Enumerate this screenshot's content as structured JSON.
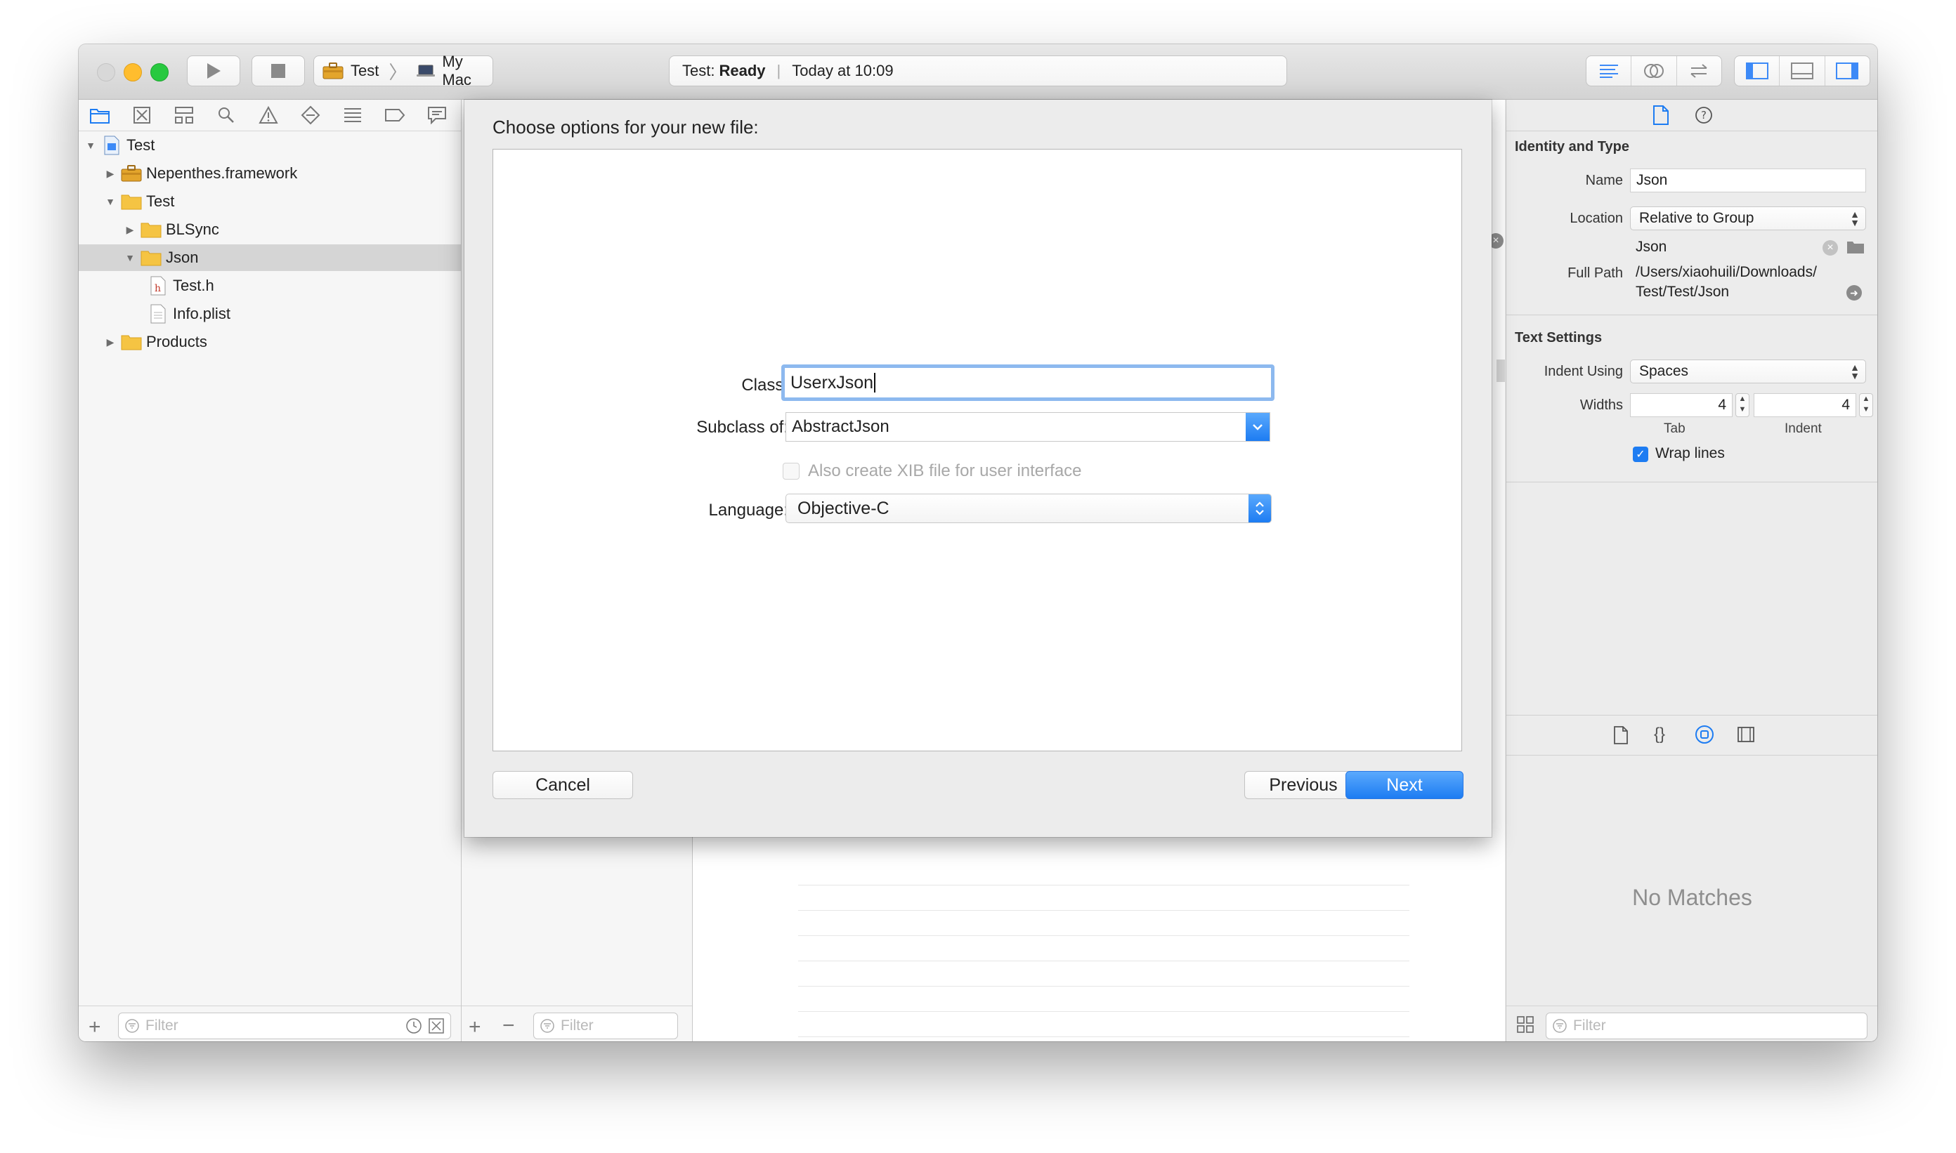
{
  "toolbar": {
    "scheme_target": "Test",
    "scheme_device": "My Mac",
    "activity_prefix": "Test:",
    "activity_status": "Ready",
    "activity_time": "Today at 10:09"
  },
  "navigator": {
    "tree": [
      {
        "label": "Test",
        "level": 0,
        "expanded": true,
        "icon": "project-icon"
      },
      {
        "label": "Nepenthes.framework",
        "level": 1,
        "expanded": false,
        "icon": "framework-icon"
      },
      {
        "label": "Test",
        "level": 1,
        "expanded": true,
        "icon": "folder-icon"
      },
      {
        "label": "BLSync",
        "level": 2,
        "expanded": false,
        "icon": "folder-icon"
      },
      {
        "label": "Json",
        "level": 2,
        "expanded": true,
        "icon": "folder-icon",
        "selected": true
      },
      {
        "label": "Test.h",
        "level": 3,
        "icon": "header-file-icon"
      },
      {
        "label": "Info.plist",
        "level": 3,
        "icon": "plist-file-icon"
      },
      {
        "label": "Products",
        "level": 1,
        "expanded": false,
        "icon": "folder-icon"
      }
    ],
    "filter_placeholder": "Filter"
  },
  "midcol": {
    "filter_placeholder": "Filter"
  },
  "dialog": {
    "title": "Choose options for your new file:",
    "class_label": "Class:",
    "class_value": "UserxJson",
    "subclass_label": "Subclass of:",
    "subclass_value": "AbstractJson",
    "xib_label": "Also create XIB file for user interface",
    "language_label": "Language:",
    "language_value": "Objective-C",
    "cancel": "Cancel",
    "previous": "Previous",
    "next": "Next"
  },
  "inspector": {
    "identity_heading": "Identity and Type",
    "name_label": "Name",
    "name_value": "Json",
    "location_label": "Location",
    "location_value": "Relative to Group",
    "location_file": "Json",
    "fullpath_label": "Full Path",
    "fullpath_line1": "/Users/xiaohuili/Downloads/",
    "fullpath_line2": "Test/Test/Json",
    "text_heading": "Text Settings",
    "indent_label": "Indent Using",
    "indent_value": "Spaces",
    "widths_label": "Widths",
    "tab_value": "4",
    "tab_caption": "Tab",
    "indent_width_value": "4",
    "indent_caption": "Indent",
    "wrap_label": "Wrap lines",
    "no_matches": "No Matches",
    "filter_placeholder": "Filter"
  },
  "colors": {
    "accent": "#1d7cf2",
    "folder": "#f5c443",
    "close": "#ff5f57",
    "minimize": "#ffbd2e",
    "zoom": "#28c940"
  }
}
